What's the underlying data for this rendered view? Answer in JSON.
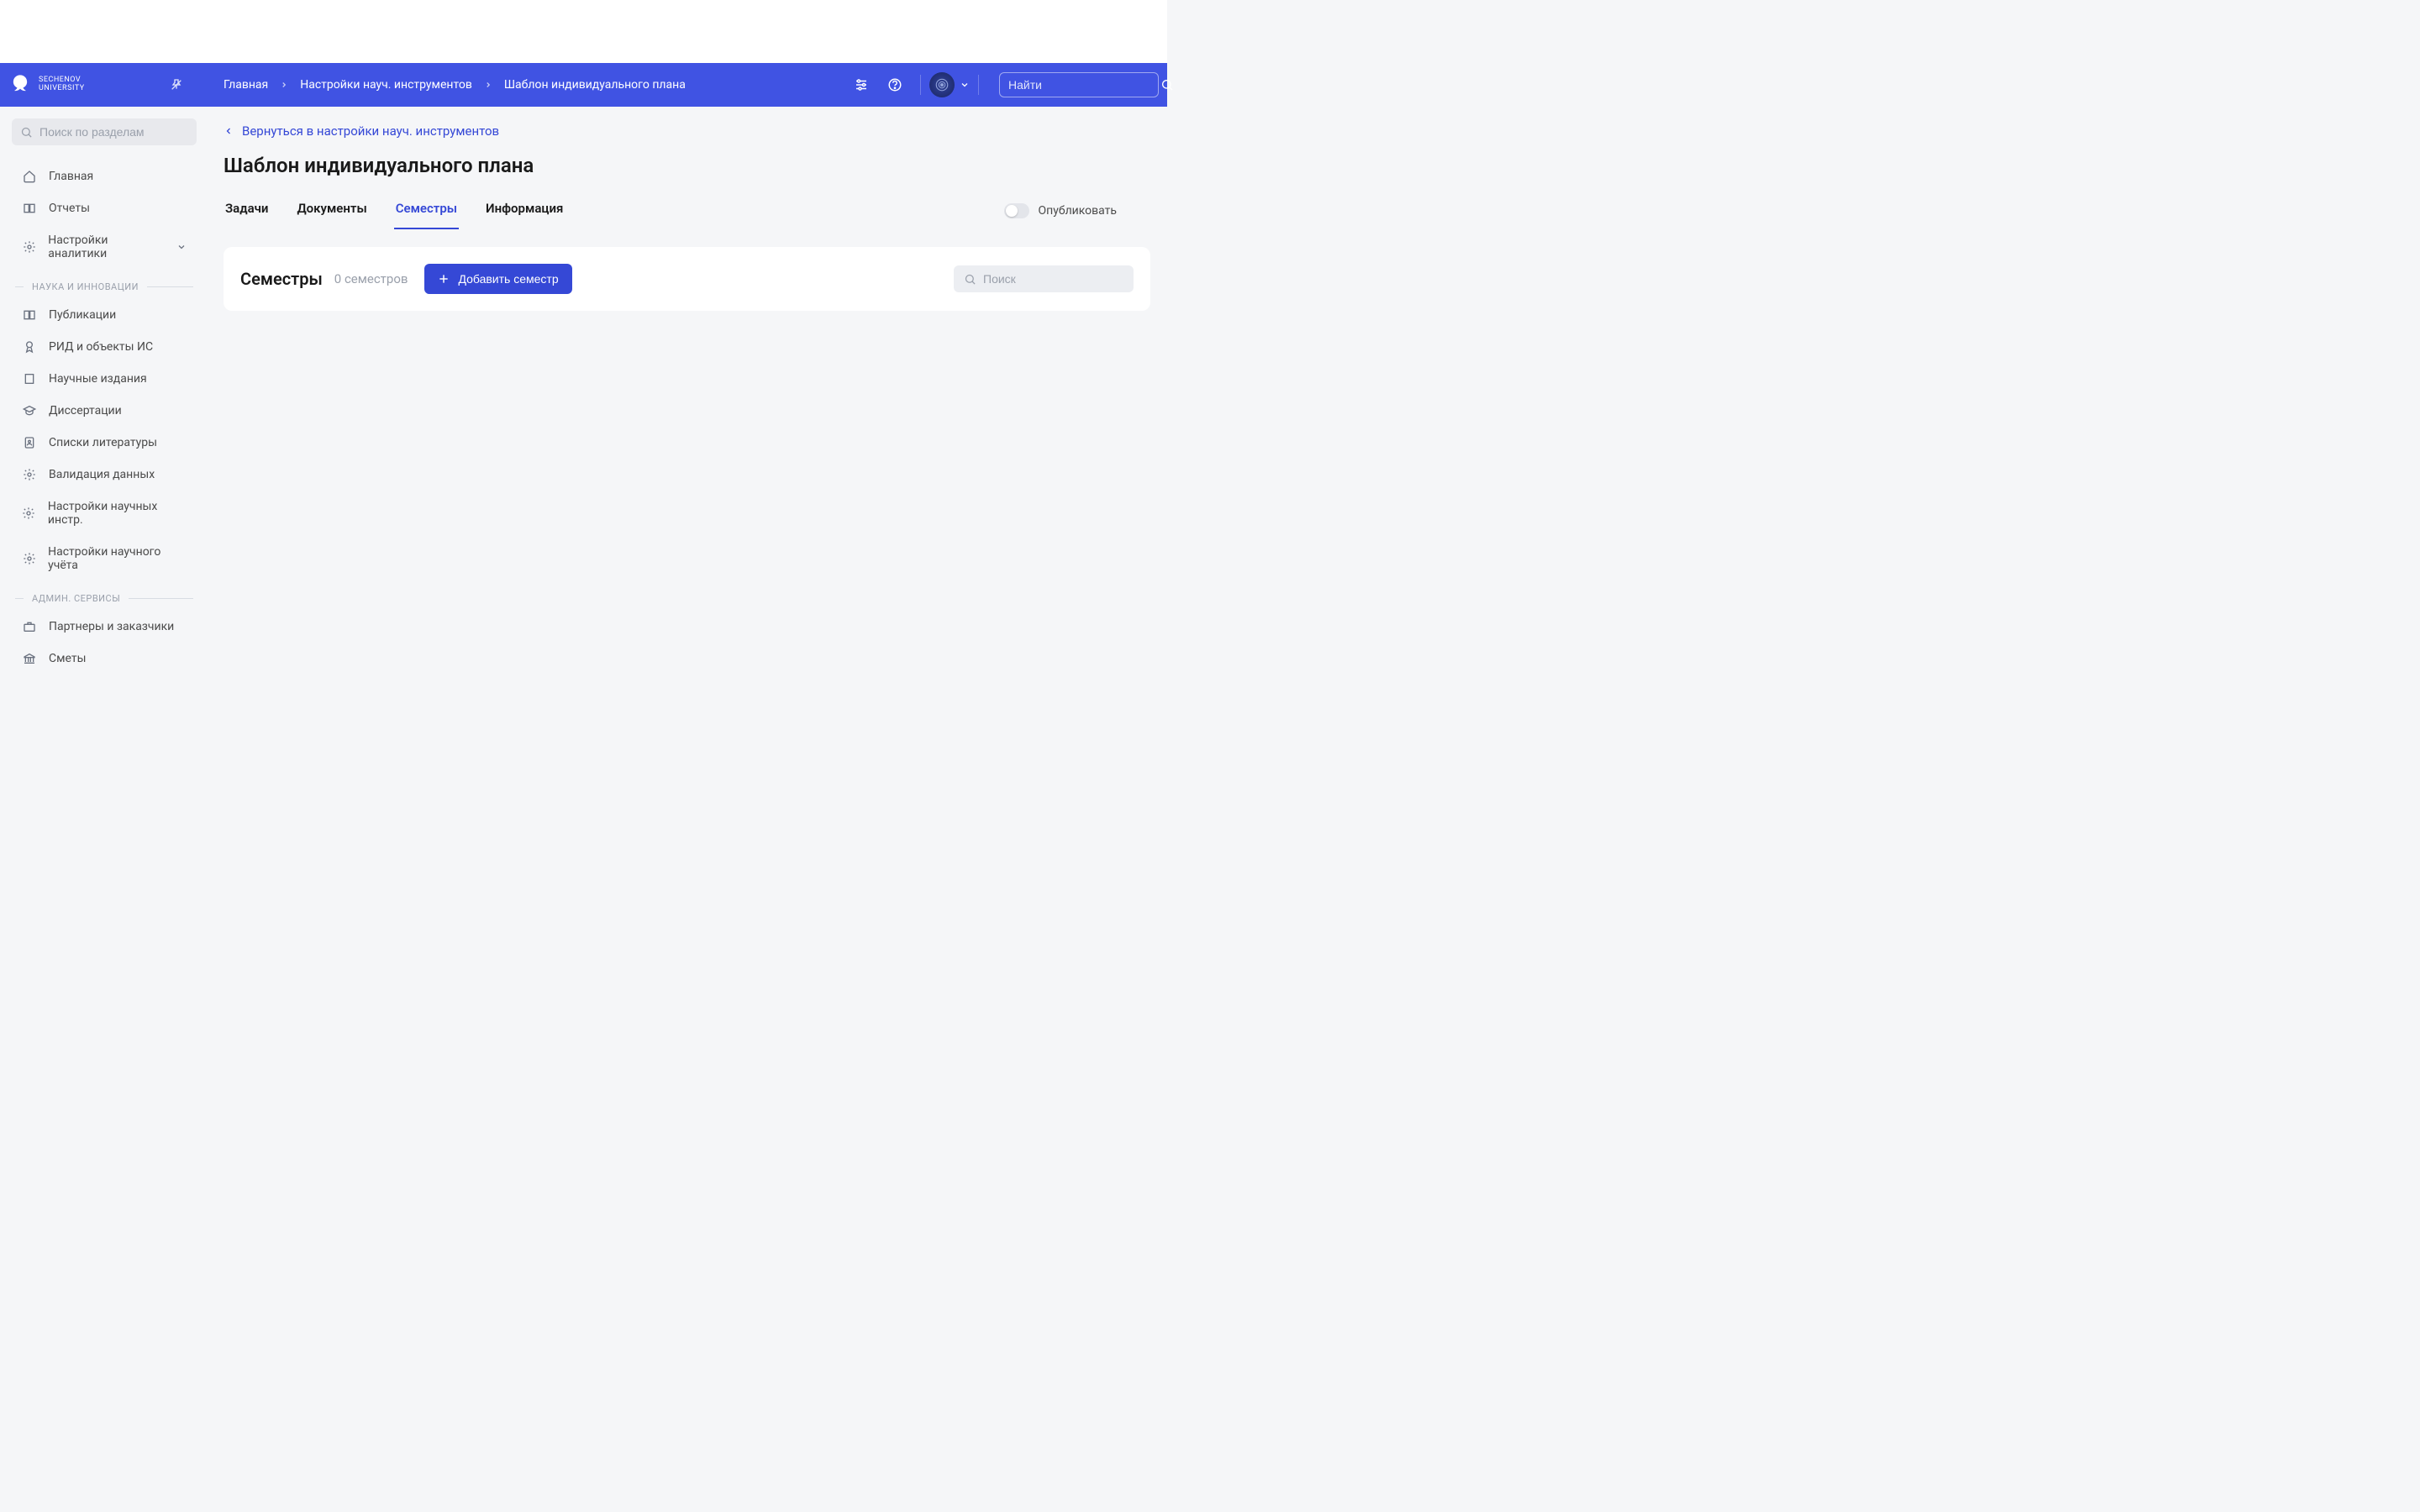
{
  "logo": {
    "line1": "SECHENOV",
    "line2": "UNIVERSITY"
  },
  "header": {
    "breadcrumb": [
      "Главная",
      "Настройки науч. инструментов",
      "Шаблон индивидуального плана"
    ],
    "search_placeholder": "Найти"
  },
  "sidebar": {
    "search_placeholder": "Поиск по разделам",
    "items_top": [
      {
        "label": "Главная",
        "icon": "home"
      },
      {
        "label": "Отчеты",
        "icon": "book"
      },
      {
        "label": "Настройки аналитики",
        "icon": "gear",
        "expandable": true
      }
    ],
    "section1_title": "НАУКА И ИННОВАЦИИ",
    "items_sci": [
      {
        "label": "Публикации",
        "icon": "book"
      },
      {
        "label": "РИД и объекты ИС",
        "icon": "award"
      },
      {
        "label": "Научные издания",
        "icon": "building"
      },
      {
        "label": "Диссертации",
        "icon": "graduation"
      },
      {
        "label": "Списки литературы",
        "icon": "contact"
      },
      {
        "label": "Валидация данных",
        "icon": "gear"
      },
      {
        "label": "Настройки научных инстр.",
        "icon": "gear"
      },
      {
        "label": "Настройки научного учёта",
        "icon": "gear"
      }
    ],
    "section2_title": "АДМИН. СЕРВИСЫ",
    "items_admin": [
      {
        "label": "Партнеры и заказчики",
        "icon": "briefcase"
      },
      {
        "label": "Сметы",
        "icon": "bank"
      }
    ]
  },
  "content": {
    "back_link": "Вернуться в настройки науч. инструментов",
    "page_title": "Шаблон индивидуального плана",
    "tabs": [
      "Задачи",
      "Документы",
      "Семестры",
      "Информация"
    ],
    "active_tab_index": 2,
    "publish_label": "Опубликовать",
    "card_title": "Семестры",
    "card_count": "0 семестров",
    "add_button": "Добавить семестр",
    "card_search_placeholder": "Поиск"
  }
}
